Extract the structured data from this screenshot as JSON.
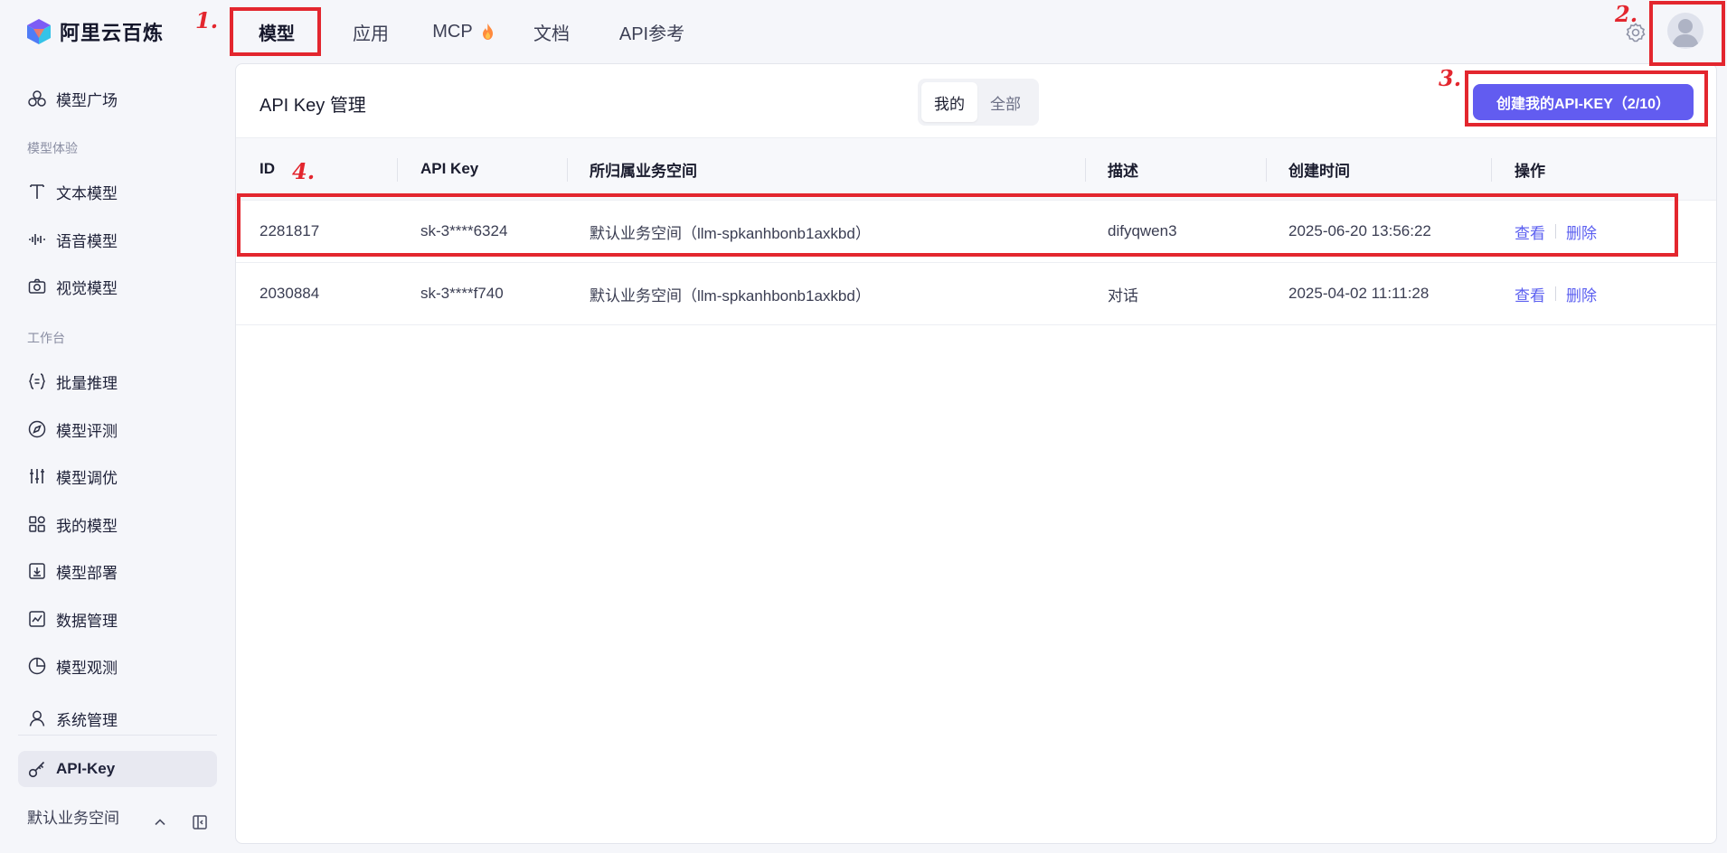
{
  "brand": {
    "name": "阿里云百炼"
  },
  "nav": {
    "tabs": [
      {
        "label": "模型"
      },
      {
        "label": "应用"
      },
      {
        "label": "MCP"
      },
      {
        "label": "文档"
      },
      {
        "label": "API参考"
      }
    ]
  },
  "sidebar": {
    "top_item": {
      "label": "模型广场",
      "icon": "model-plaza-icon"
    },
    "section1": "模型体验",
    "experience_items": [
      {
        "label": "文本模型",
        "icon": "text-icon"
      },
      {
        "label": "语音模型",
        "icon": "audio-wave-icon"
      },
      {
        "label": "视觉模型",
        "icon": "camera-icon"
      }
    ],
    "section2": "工作台",
    "workbench_items": [
      {
        "label": "批量推理",
        "icon": "braces-icon"
      },
      {
        "label": "模型评测",
        "icon": "compass-icon"
      },
      {
        "label": "模型调优",
        "icon": "sliders-icon"
      },
      {
        "label": "我的模型",
        "icon": "grid-icon"
      },
      {
        "label": "模型部署",
        "icon": "download-box-icon"
      },
      {
        "label": "数据管理",
        "icon": "line-chart-icon"
      },
      {
        "label": "模型观测",
        "icon": "pie-chart-icon"
      }
    ],
    "bottom_items": [
      {
        "label": "系统管理",
        "icon": "user-icon"
      },
      {
        "label": "API-Key",
        "icon": "key-icon",
        "active": true
      }
    ],
    "workspace": "默认业务空间"
  },
  "page": {
    "title": "API Key 管理",
    "segments": [
      "我的",
      "全部"
    ],
    "selected_segment": "我的",
    "create_button": "创建我的API-KEY（2/10）",
    "columns": [
      "ID",
      "API Key",
      "所归属业务空间",
      "描述",
      "创建时间",
      "操作"
    ],
    "rows": [
      {
        "id": "2281817",
        "key": "sk-3****6324",
        "workspace": "默认业务空间（llm-spkanhbonb1axkbd）",
        "desc": "difyqwen3",
        "created": "2025-06-20 13:56:22",
        "view": "查看",
        "delete": "删除"
      },
      {
        "id": "2030884",
        "key": "sk-3****f740",
        "workspace": "默认业务空间（llm-spkanhbonb1axkbd）",
        "desc": "对话",
        "created": "2025-04-02 11:11:28",
        "view": "查看",
        "delete": "删除"
      }
    ]
  },
  "annotations": {
    "n1": "1.",
    "n2": "2.",
    "n3": "3.",
    "n4": "4."
  },
  "colors": {
    "accent": "#625cf0",
    "link": "#5b5ff0",
    "annotation": "#e3262e"
  }
}
